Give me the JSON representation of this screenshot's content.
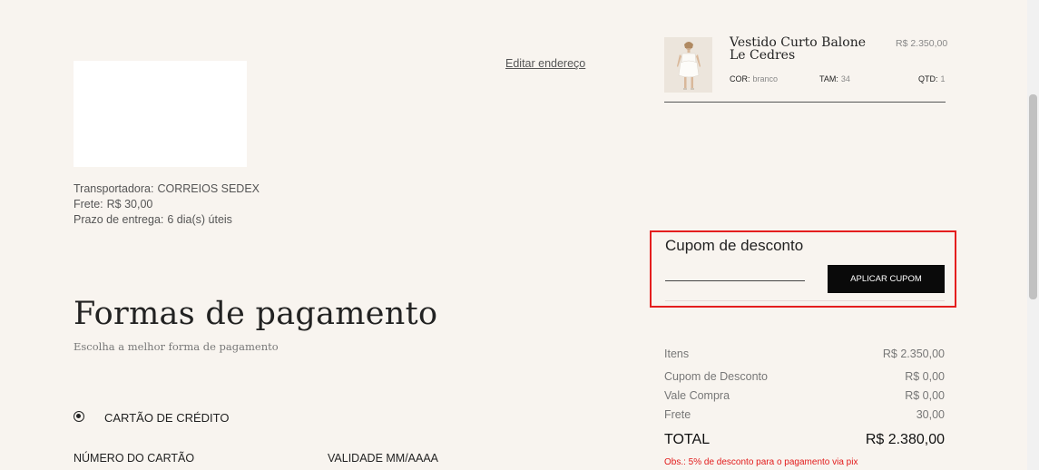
{
  "address": {
    "edit_label": "Editar endereço"
  },
  "shipping": {
    "carrier_label": "Transportadora:",
    "carrier_value": "CORREIOS SEDEX",
    "freight_label": "Frete:",
    "freight_value": "R$ 30,00",
    "delivery_label": "Prazo de entrega:",
    "delivery_value": "6 dia(s) úteis"
  },
  "payment": {
    "title": "Formas de pagamento",
    "subtitle": "Escolha a melhor forma de pagamento",
    "method_label": "CARTÃO DE CRÉDITO",
    "card_number_label": "NÚMERO DO CARTÃO",
    "expiry_label": "VALIDADE MM/AAAA"
  },
  "cart": {
    "item": {
      "name": "Vestido Curto Balone Le Cedres",
      "price": "R$ 2.350,00",
      "color_label": "COR:",
      "color_value": "branco",
      "size_label": "TAM:",
      "size_value": "34",
      "qty_label": "QTD:",
      "qty_value": "1"
    }
  },
  "coupon": {
    "title": "Cupom de desconto",
    "input_value": "",
    "button_label": "APLICAR CUPOM"
  },
  "summary": {
    "items_label": "Itens",
    "items_value": "R$ 2.350,00",
    "discount_label": "Cupom de Desconto",
    "discount_value": "R$ 0,00",
    "voucher_label": "Vale Compra",
    "voucher_value": "R$ 0,00",
    "freight_label": "Frete",
    "freight_value": "30,00",
    "total_label": "TOTAL",
    "total_value": "R$ 2.380,00",
    "note": "Obs.: 5% de desconto para o pagamento via pix"
  },
  "colors": {
    "background": "#f8f4ef",
    "highlight_frame": "#e41e1e",
    "button_bg": "#0a0a0a",
    "note_red": "#e21b1b"
  }
}
